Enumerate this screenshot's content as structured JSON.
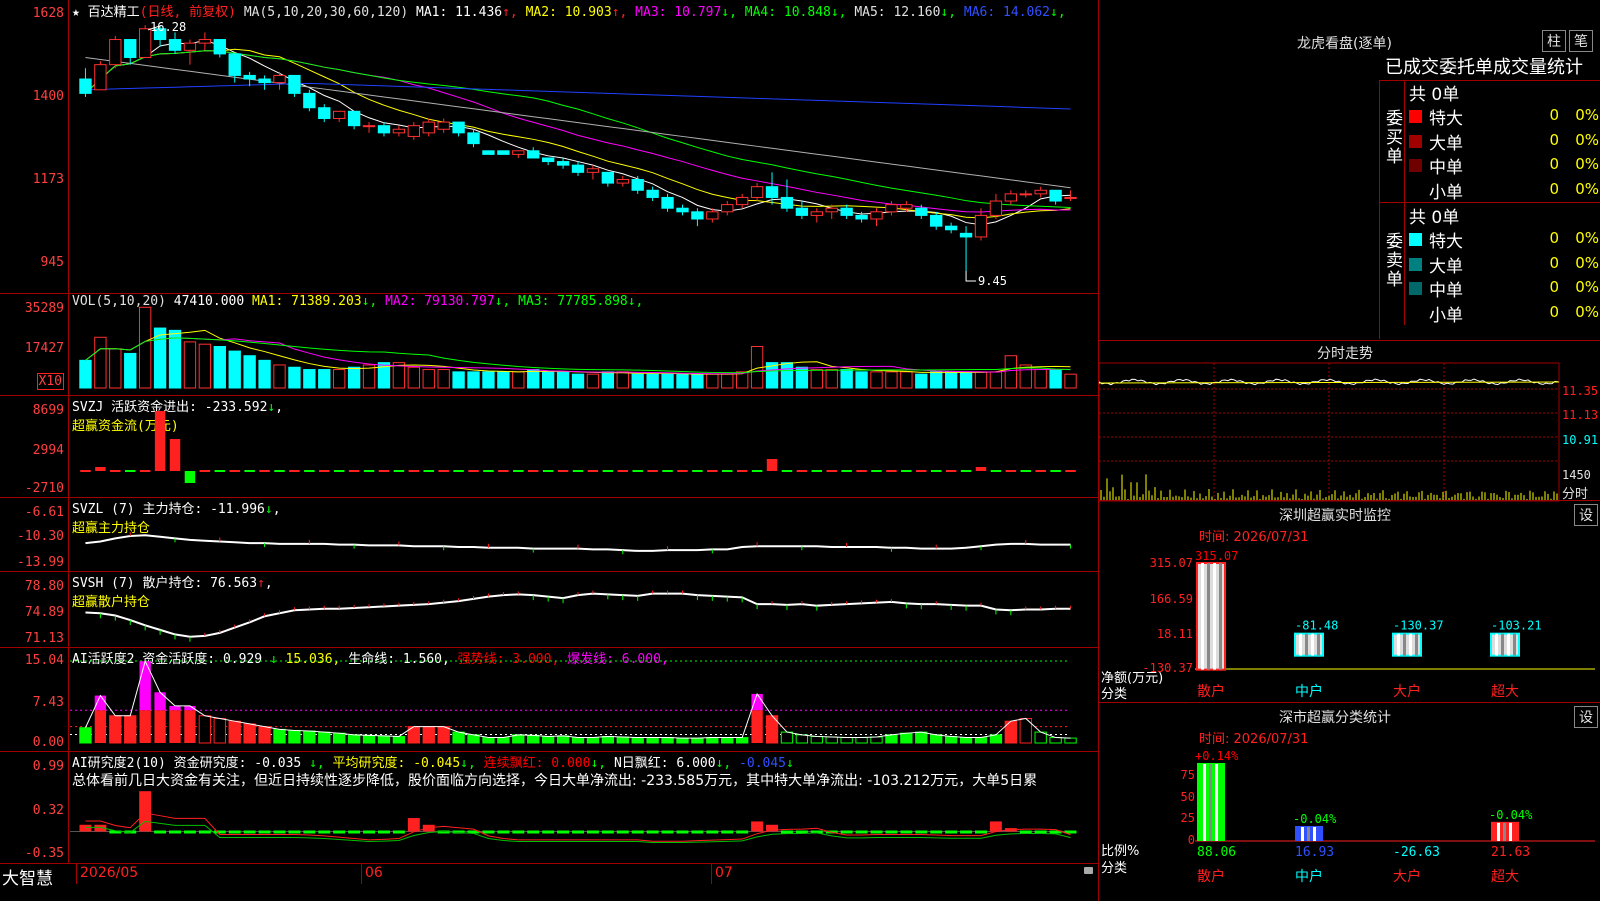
{
  "stock": {
    "star": "★",
    "name": "百达精工",
    "mode": "(日线, 前复权)"
  },
  "main_panel": {
    "ma_header": "MA(5,10,20,30,60,120)",
    "ma": [
      {
        "label": "MA1: 11.436",
        "arrow": "↑",
        "color": "#ffffff"
      },
      {
        "label": "MA2: 10.903",
        "arrow": "↑",
        "color": "#ffff00"
      },
      {
        "label": "MA3: 10.797",
        "arrow": "↓",
        "color": "#ff00ff"
      },
      {
        "label": "MA4: 10.848",
        "arrow": "↓",
        "color": "#00ff00"
      },
      {
        "label": "MA5: 12.160",
        "arrow": "↓",
        "color": "#e0e0e0"
      },
      {
        "label": "MA6: 14.062",
        "arrow": "↓",
        "color": "#3050ff"
      }
    ],
    "y_labels": [
      "1628",
      "1400",
      "1173",
      "945"
    ],
    "high_marker": "16.28",
    "low_marker": "9.45"
  },
  "vol_panel": {
    "header": "VOL(5,10,20)",
    "value": "47410.000",
    "ma": [
      {
        "label": "MA1: 71389.203",
        "arrow": "↓",
        "color": "#ffff00"
      },
      {
        "label": "MA2: 79130.797",
        "arrow": "↓",
        "color": "#ff00ff"
      },
      {
        "label": "MA3: 77785.898",
        "arrow": "↓",
        "color": "#00ff00"
      }
    ],
    "y_labels": [
      "35289",
      "17427"
    ],
    "unit": "X10"
  },
  "svzj_panel": {
    "header": "SVZJ  活跃资金进出: -233.592",
    "arrow": "↓",
    "sub": "超赢资金流(万元)",
    "y_labels": [
      "8699",
      "2994",
      "-2710"
    ]
  },
  "svzl_panel": {
    "header": "SVZL (7) 主力持仓: -11.996",
    "arrow": "↓",
    "sub": "超赢主力持仓",
    "y_labels": [
      "-6.61",
      "-10.30",
      "-13.99"
    ]
  },
  "svsh_panel": {
    "header": "SVSH (7) 散户持仓: 76.563",
    "arrow": "↑",
    "sub": "超赢散户持仓",
    "y_labels": [
      "78.80",
      "74.89",
      "71.13"
    ]
  },
  "ai_active_panel": {
    "header": "AI活跃度2 资金活跃度: 0.929",
    "parts": [
      {
        "label": "15.036,",
        "color": "#ffff00",
        "arrow_before": "↓"
      },
      {
        "label": "生命线: 1.560,",
        "color": "#ffffff"
      },
      {
        "label": "强势线: 3.000,",
        "color": "#ff0000"
      },
      {
        "label": "爆发线: 6.000,",
        "color": "#ff00ff"
      }
    ],
    "y_labels": [
      "15.04",
      "7.43",
      "0.00"
    ]
  },
  "ai_research_panel": {
    "header": "AI研究度2(10) 资金研究度: -0.035",
    "parts": [
      {
        "label": "平均研究度: -0.045",
        "color": "#ffff00"
      },
      {
        "label": "连续飘红: 0.000",
        "color": "#ff0000"
      },
      {
        "label": "N日飘红: 6.000",
        "color": "#ffffff"
      },
      {
        "label": "-0.045",
        "color": "#3050ff"
      }
    ],
    "summary": "总体看前几日大资金有关注，但近日持续性逐步降低，股价面临方向选择，今日大单净流出: -233.585万元，其中特大单净流出: -103.212万元，大单5日累",
    "y_labels": [
      "0.99",
      "0.32",
      "-0.35"
    ]
  },
  "footer": {
    "logo": "大智慧",
    "dates": [
      "2026/05",
      "06",
      "07"
    ]
  },
  "lhb": {
    "title": "龙虎看盘(逐单)",
    "btn1": "柱",
    "btn2": "笔",
    "heading": "已成交委托单成交量统计",
    "buy_label": "委买单",
    "sell_label": "委卖单",
    "buy_total": "共 0单",
    "sell_total": "共 0单",
    "buy_rows": [
      {
        "name": "特大",
        "count": "0",
        "pct": "0%",
        "color": "#ff0000"
      },
      {
        "name": "大单",
        "count": "0",
        "pct": "0%",
        "color": "#a00000"
      },
      {
        "name": "中单",
        "count": "0",
        "pct": "0%",
        "color": "#700000"
      },
      {
        "name": "小单",
        "count": "0",
        "pct": "0%",
        "color": "#000000"
      }
    ],
    "sell_rows": [
      {
        "name": "特大",
        "count": "0",
        "pct": "0%",
        "color": "#00ffff"
      },
      {
        "name": "大单",
        "count": "0",
        "pct": "0%",
        "color": "#008080"
      },
      {
        "name": "中单",
        "count": "0",
        "pct": "0%",
        "color": "#006868"
      },
      {
        "name": "小单",
        "count": "0",
        "pct": "0%",
        "color": "#000000"
      }
    ]
  },
  "intraday": {
    "title": "分时走势",
    "prices": [
      "11.35",
      "11.13",
      "10.91"
    ],
    "vol_label": "1450",
    "minutes_label": "分时"
  },
  "monitor": {
    "title": "深圳超赢实时监控",
    "set_btn": "设",
    "time": "时间: 2026/07/31",
    "y_labels": [
      "315.07",
      "166.59",
      "18.11",
      "-130.37"
    ],
    "unit_label": "净额(万元)",
    "class_label": "分类",
    "bars": [
      {
        "cat": "散户",
        "value": 315.07,
        "label": "315.07",
        "label_color": "#ff0000"
      },
      {
        "cat": "中户",
        "value": -81.48,
        "label": "-81.48",
        "label_color": "#00ffff"
      },
      {
        "cat": "大户",
        "value": -130.37,
        "label": "-130.37",
        "label_color": "#00ffff"
      },
      {
        "cat": "超大",
        "value": -103.21,
        "label": "-103.21",
        "label_color": "#00ffff"
      }
    ]
  },
  "classify": {
    "title": "深市超赢分类统计",
    "set_btn": "设",
    "time": "时间: 2026/07/31",
    "y_labels": [
      "75",
      "50",
      "25",
      "0"
    ],
    "ratio_label": "比例%",
    "class_label": "分类",
    "bars": [
      {
        "cat": "散户",
        "value": 88.06,
        "label": "88.06",
        "top": "+0.14%",
        "top_color": "#ff0000",
        "color": "#00ff00"
      },
      {
        "cat": "中户",
        "value": 16.93,
        "label": "16.93",
        "top": "-0.04%",
        "top_color": "#00ff00",
        "color": "#3050ff"
      },
      {
        "cat": "大户",
        "value": -26.63,
        "label": "-26.63",
        "top": "",
        "top_color": "#00ff00",
        "color": "#00ffff"
      },
      {
        "cat": "超大",
        "value": 21.63,
        "label": "21.63",
        "top": "-0.04%",
        "top_color": "#00ff00",
        "color": "#ff2020"
      }
    ]
  },
  "chart_data": {
    "type": "candlestick",
    "candles": [
      [
        14.8,
        15.1,
        14.3,
        14.4
      ],
      [
        14.5,
        15.3,
        14.5,
        15.2
      ],
      [
        15.2,
        16.0,
        15.1,
        15.9
      ],
      [
        15.9,
        15.9,
        15.2,
        15.4
      ],
      [
        15.4,
        16.3,
        15.4,
        16.2
      ],
      [
        16.2,
        16.28,
        15.7,
        15.9
      ],
      [
        15.9,
        16.1,
        15.5,
        15.6
      ],
      [
        15.6,
        15.9,
        15.2,
        15.8
      ],
      [
        15.8,
        16.1,
        15.6,
        15.9
      ],
      [
        15.9,
        15.9,
        15.4,
        15.5
      ],
      [
        15.5,
        15.5,
        14.7,
        14.9
      ],
      [
        14.9,
        15.0,
        14.6,
        14.8
      ],
      [
        14.8,
        14.9,
        14.5,
        14.7
      ],
      [
        14.7,
        15.0,
        14.5,
        14.9
      ],
      [
        14.9,
        14.9,
        14.3,
        14.4
      ],
      [
        14.4,
        14.5,
        13.9,
        14.0
      ],
      [
        14.0,
        14.1,
        13.6,
        13.7
      ],
      [
        13.7,
        13.9,
        13.6,
        13.9
      ],
      [
        13.9,
        13.9,
        13.4,
        13.5
      ],
      [
        13.5,
        13.6,
        13.3,
        13.5
      ],
      [
        13.5,
        13.6,
        13.2,
        13.3
      ],
      [
        13.3,
        13.5,
        13.2,
        13.4
      ],
      [
        13.2,
        13.6,
        13.1,
        13.5
      ],
      [
        13.3,
        13.7,
        13.2,
        13.6
      ],
      [
        13.4,
        13.7,
        13.3,
        13.6
      ],
      [
        13.6,
        13.6,
        13.2,
        13.3
      ],
      [
        13.3,
        13.4,
        12.9,
        13.0
      ],
      [
        12.8,
        12.8,
        12.7,
        12.7
      ],
      [
        12.8,
        12.8,
        12.7,
        12.7
      ],
      [
        12.7,
        12.8,
        12.6,
        12.8
      ],
      [
        12.8,
        12.9,
        12.6,
        12.6
      ],
      [
        12.6,
        12.6,
        12.4,
        12.5
      ],
      [
        12.5,
        12.6,
        12.3,
        12.4
      ],
      [
        12.4,
        12.5,
        12.1,
        12.2
      ],
      [
        12.2,
        12.4,
        12.0,
        12.3
      ],
      [
        12.2,
        12.2,
        11.8,
        11.9
      ],
      [
        11.9,
        12.1,
        11.8,
        12.0
      ],
      [
        12.0,
        12.1,
        11.6,
        11.7
      ],
      [
        11.7,
        11.8,
        11.4,
        11.5
      ],
      [
        11.5,
        11.6,
        11.1,
        11.2
      ],
      [
        11.2,
        11.3,
        11.0,
        11.1
      ],
      [
        11.1,
        11.2,
        10.7,
        10.9
      ],
      [
        10.9,
        11.2,
        10.8,
        11.1
      ],
      [
        11.1,
        11.4,
        11.0,
        11.3
      ],
      [
        11.3,
        11.6,
        11.2,
        11.5
      ],
      [
        11.5,
        11.9,
        11.4,
        11.8
      ],
      [
        11.8,
        12.2,
        11.3,
        11.5
      ],
      [
        11.5,
        12.0,
        11.1,
        11.2
      ],
      [
        11.2,
        11.4,
        10.9,
        11.0
      ],
      [
        11.0,
        11.2,
        10.8,
        11.1
      ],
      [
        11.1,
        11.3,
        10.9,
        11.2
      ],
      [
        11.2,
        11.3,
        10.9,
        11.0
      ],
      [
        11.0,
        11.1,
        10.8,
        10.9
      ],
      [
        10.9,
        11.2,
        10.7,
        11.1
      ],
      [
        11.1,
        11.4,
        11.0,
        11.3
      ],
      [
        11.2,
        11.4,
        11.1,
        11.3
      ],
      [
        11.2,
        11.3,
        10.9,
        11.0
      ],
      [
        11.0,
        11.1,
        10.6,
        10.7
      ],
      [
        10.7,
        10.8,
        10.5,
        10.6
      ],
      [
        10.5,
        10.7,
        9.45,
        10.4
      ],
      [
        10.4,
        11.2,
        10.3,
        11.0
      ],
      [
        11.0,
        11.6,
        10.9,
        11.4
      ],
      [
        11.4,
        11.7,
        11.3,
        11.6
      ],
      [
        11.6,
        11.7,
        11.5,
        11.6
      ],
      [
        11.6,
        11.8,
        11.5,
        11.7
      ],
      [
        11.7,
        11.7,
        11.3,
        11.4
      ],
      [
        11.5,
        11.7,
        11.4,
        11.5
      ]
    ],
    "volume": [
      12,
      22,
      17,
      15,
      35,
      26,
      25,
      20,
      19,
      18,
      16,
      14,
      12,
      10,
      9,
      8,
      8,
      8,
      9,
      10,
      11,
      11,
      9,
      8,
      8,
      7,
      7,
      7,
      7,
      7,
      8,
      7,
      7,
      6,
      6,
      7,
      7,
      6,
      6,
      6,
      6,
      6,
      6,
      6,
      7,
      18,
      11,
      11,
      9,
      8,
      8,
      8,
      7,
      7,
      7,
      7,
      6,
      7,
      7,
      7,
      7,
      7,
      14,
      10,
      8,
      8,
      6
    ],
    "svzj": [
      0,
      1,
      0,
      0,
      0,
      15,
      8,
      -3,
      0,
      0,
      0,
      0,
      0,
      0,
      0,
      0,
      0,
      0,
      0,
      0,
      0,
      0,
      0,
      0,
      0,
      0,
      0,
      0,
      0,
      0,
      0,
      0,
      0,
      0,
      0,
      0,
      0,
      0,
      0,
      0,
      0,
      0,
      0,
      0,
      0,
      0,
      3,
      0,
      0,
      0,
      0,
      0,
      0,
      0,
      0,
      0,
      0,
      0,
      0,
      0,
      1,
      0,
      0,
      0,
      0,
      0,
      0
    ],
    "svzl": [
      -11.2,
      -11.0,
      -10.6,
      -10.3,
      -10.2,
      -10.4,
      -10.6,
      -10.8,
      -10.9,
      -11.0,
      -11.1,
      -11.2,
      -11.2,
      -11.3,
      -11.3,
      -11.3,
      -11.3,
      -11.4,
      -11.4,
      -11.5,
      -11.5,
      -11.5,
      -11.6,
      -11.6,
      -11.6,
      -11.7,
      -11.7,
      -11.8,
      -11.8,
      -11.8,
      -11.9,
      -11.9,
      -11.9,
      -11.9,
      -12.0,
      -12.0,
      -12.1,
      -12.2,
      -12.2,
      -12.1,
      -12.1,
      -12.1,
      -12.0,
      -12.0,
      -11.7,
      -11.6,
      -11.6,
      -11.6,
      -11.6,
      -11.6,
      -11.7,
      -11.7,
      -11.7,
      -11.7,
      -11.8,
      -11.8,
      -11.9,
      -11.9,
      -11.9,
      -11.8,
      -11.6,
      -11.4,
      -11.3,
      -11.3,
      -11.4,
      -11.4,
      -11.4
    ],
    "svsh": [
      74.9,
      74.8,
      74.5,
      73.9,
      73.2,
      72.6,
      72.0,
      71.7,
      71.8,
      72.2,
      72.9,
      73.6,
      74.4,
      74.8,
      75.2,
      75.3,
      75.4,
      75.4,
      75.5,
      75.6,
      75.7,
      75.8,
      75.9,
      76.0,
      76.2,
      76.4,
      76.7,
      77.0,
      77.2,
      77.3,
      77.2,
      77.0,
      76.8,
      77.2,
      77.4,
      77.3,
      77.2,
      77.1,
      77.4,
      77.4,
      77.4,
      77.2,
      77.1,
      77.0,
      76.9,
      76.0,
      76.0,
      75.9,
      76.0,
      75.8,
      75.9,
      76.0,
      76.1,
      76.2,
      76.3,
      76.1,
      76.0,
      76.0,
      75.9,
      75.8,
      75.8,
      75.3,
      75.2,
      75.3,
      75.3,
      75.4,
      75.4
    ],
    "ai_active": [
      2.8,
      8.7,
      5.0,
      5.0,
      15.0,
      9.3,
      6.8,
      6.8,
      5.0,
      4.5,
      4.0,
      3.5,
      3.0,
      2.5,
      2.3,
      2.2,
      2.0,
      1.8,
      1.5,
      1.4,
      1.3,
      1.2,
      3.0,
      3.0,
      3.0,
      2.0,
      1.5,
      1.0,
      1.0,
      1.5,
      1.4,
      1.2,
      1.3,
      1.0,
      1.0,
      1.2,
      1.1,
      1.0,
      1.0,
      1.0,
      0.9,
      0.9,
      1.0,
      1.0,
      1.0,
      9.0,
      5.0,
      2.0,
      1.5,
      1.2,
      1.1,
      1.0,
      1.0,
      1.1,
      1.5,
      1.8,
      2.0,
      1.5,
      1.2,
      1.0,
      1.0,
      1.5,
      4.0,
      4.5,
      2.0,
      1.0,
      0.9
    ],
    "ai_research": [
      0.1,
      0.1,
      0.0,
      0.0,
      0.6,
      0.0,
      0.0,
      0.0,
      0.0,
      0.0,
      0.0,
      0.0,
      0.0,
      0.0,
      0.0,
      -0.02,
      -0.03,
      -0.05,
      -0.05,
      -0.05,
      0.0,
      0.0,
      0.2,
      0.1,
      0.0,
      -0.05,
      -0.05,
      -0.05,
      0.0,
      -0.05,
      -0.05,
      -0.05,
      -0.05,
      0.0,
      -0.05,
      -0.05,
      -0.05,
      -0.05,
      -0.05,
      -0.05,
      -0.05,
      -0.03,
      -0.03,
      -0.03,
      -0.03,
      0.15,
      0.1,
      0.0,
      -0.02,
      0.0,
      0.0,
      0.0,
      0.0,
      0.0,
      0.0,
      0.0,
      0.0,
      -0.02,
      -0.02,
      0.0,
      0.0,
      0.15,
      0.05,
      0.0,
      0.0,
      -0.02,
      -0.035
    ],
    "ylim_main": [
      9.45,
      16.28
    ]
  }
}
